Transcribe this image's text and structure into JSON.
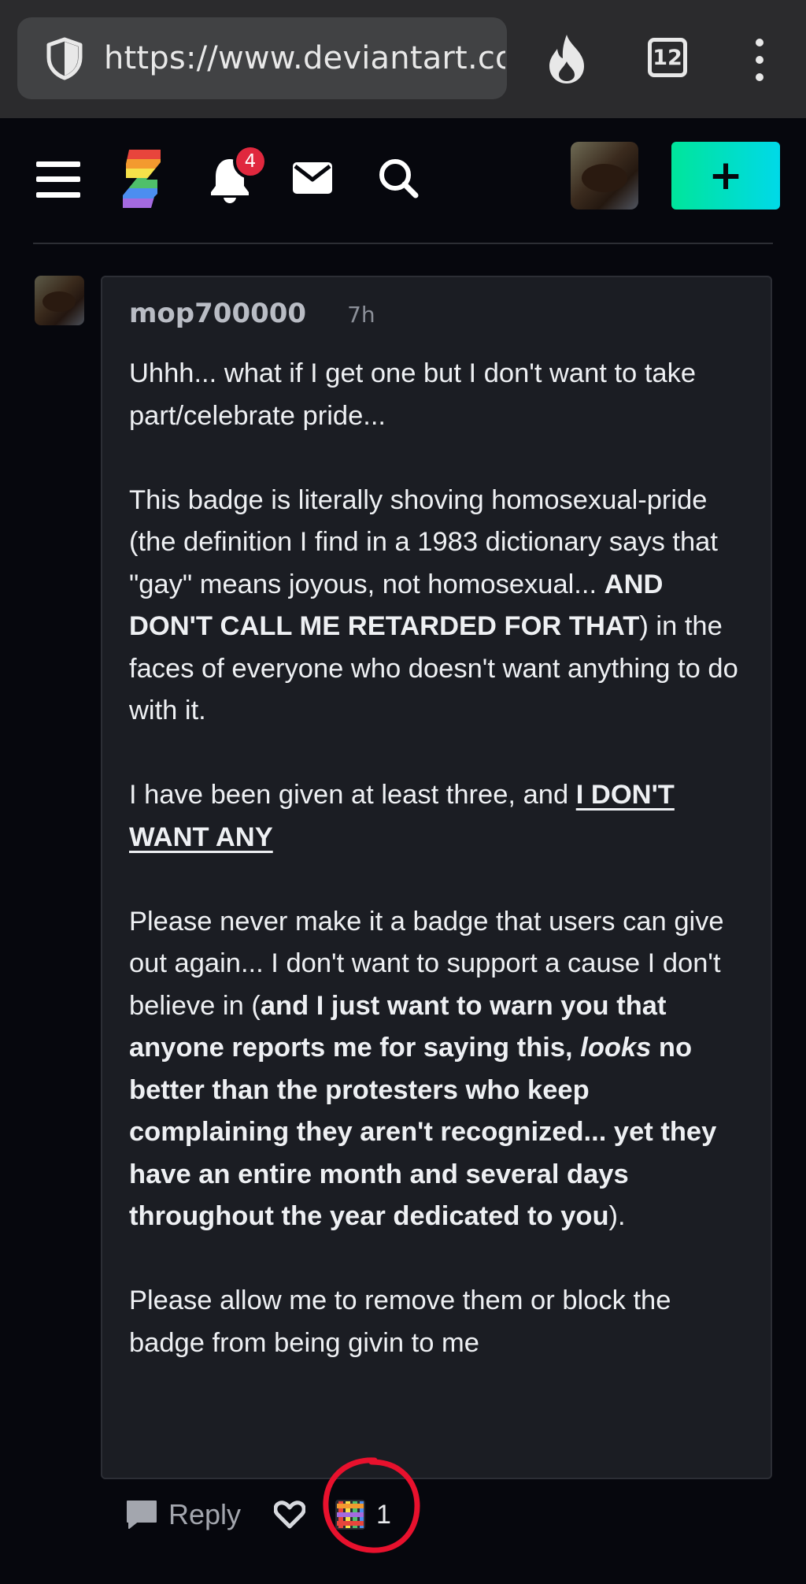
{
  "browser": {
    "url": "https://www.deviantart.co",
    "tab_count": "12"
  },
  "header": {
    "notification_count": "4",
    "create_label": "+"
  },
  "comment": {
    "username": "mop700000",
    "time": "7h",
    "p1": "Uhhh... what if I get one but I don't want to take part/celebrate pride...",
    "p2_a": "This badge is literally shoving homosexual-pride (the definition I find in a 1983 dictionary says that \"gay\" means joyous, not homosexual... ",
    "p2_b": "AND DON'T CALL ME RETARDED FOR THAT",
    "p2_c": ") in the faces of everyone who doesn't want anything to do with it.",
    "p3_a": "I have been given at least three, and ",
    "p3_b": "I DON'T WANT ANY",
    "p4_a": "Please never make it a badge that users can give out again... I don't want to support a cause I don't believe in (",
    "p4_b": "and I just want to warn you that anyone reports me for saying this, ",
    "p4_c": "looks",
    "p4_d": " no better than the protesters who keep complaining they aren't recognized... yet they have an entire month and several days throughout the year dedicated to you",
    "p4_e": ").",
    "p5": "Please allow me to remove them or block the badge from being givin to me"
  },
  "actions": {
    "reply_label": "Reply",
    "badge_count": "1"
  },
  "colors": {
    "accent_gradient_start": "#00e59b",
    "accent_gradient_end": "#00d9e8",
    "notification_badge": "#e0283e",
    "annotation_circle": "#e8112d"
  }
}
